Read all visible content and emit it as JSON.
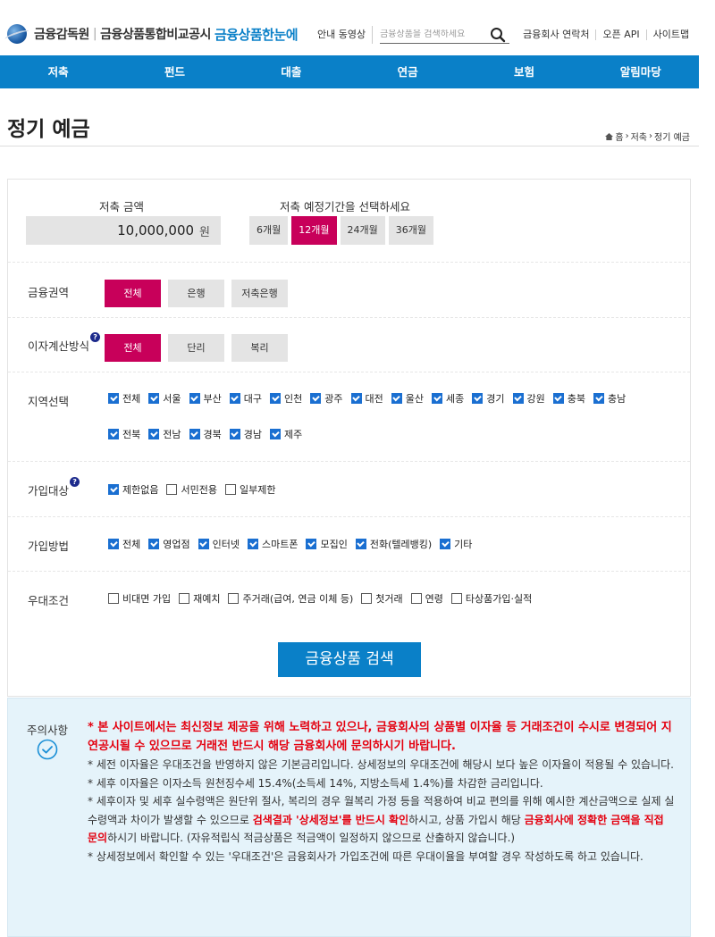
{
  "header": {
    "org1": "금융감독원",
    "org2": "금융상품통합비교공시",
    "brand": "금융상품한눈에",
    "links": [
      "안내 동영상",
      "금융회사 연락처",
      "오픈 API",
      "사이트맵"
    ],
    "search_placeholder": "금융상품을 검색하세요"
  },
  "nav": [
    "저축",
    "펀드",
    "대출",
    "연금",
    "보험",
    "알림마당"
  ],
  "page": {
    "title": "정기 예금",
    "breadcrumb": [
      "홈",
      "저축",
      "정기 예금"
    ]
  },
  "form": {
    "amount_label": "저축 금액",
    "amount_value": "10,000,000",
    "amount_unit": "원",
    "period_label": "저축 예정기간을 선택하세요",
    "periods": [
      "6개월",
      "12개월",
      "24개월",
      "36개월"
    ],
    "period_selected": "12개월",
    "sector_label": "금융권역",
    "sectors": [
      "전체",
      "은행",
      "저축은행"
    ],
    "interest_label": "이자계산방식",
    "interest_opts": [
      "전체",
      "단리",
      "복리"
    ],
    "region_label": "지역선택",
    "regions_row1": [
      "전체",
      "서울",
      "부산",
      "대구",
      "인천",
      "광주",
      "대전",
      "울산",
      "세종",
      "경기",
      "강원",
      "충북",
      "충남"
    ],
    "regions_row2": [
      "전북",
      "전남",
      "경북",
      "경남",
      "제주"
    ],
    "target_label": "가입대상",
    "targets": [
      {
        "label": "제한없음",
        "checked": true
      },
      {
        "label": "서민전용",
        "checked": false
      },
      {
        "label": "일부제한",
        "checked": false
      }
    ],
    "method_label": "가입방법",
    "methods": [
      "전체",
      "영업점",
      "인터넷",
      "스마트폰",
      "모집인",
      "전화(텔레뱅킹)",
      "기타"
    ],
    "pref_label": "우대조건",
    "prefs": [
      "비대면 가입",
      "재예치",
      "주거래(급여, 연금 이체 등)",
      "첫거래",
      "연령",
      "타상품가입·실적"
    ],
    "help_glyph": "?",
    "search_button": "금융상품 검색"
  },
  "notice": {
    "label": "주의사항",
    "lead": "* 본 사이트에서는 최신정보 제공을 위해 노력하고 있으나, 금융회사의 상품별 이자율 등 거래조건이 수시로 변경되어 지연공시될 수 있으므로 거래전 반드시 해당 금융회사에 문의하시기 바랍니다.",
    "p1": "* 세전 이자율은 우대조건을 반영하지 않은 기본금리입니다. 상세정보의 우대조건에 해당시 보다 높은 이자율이 적용될 수 있습니다.",
    "p2": "* 세후 이자율은 이자소득 원천징수세 15.4%(소득세 14%, 지방소득세 1.4%)를 차감한 금리입니다.",
    "p3a": "* 세후이자 및 세후 실수령액은 원단위 절사, 복리의 경우 월복리 가정 등을 적용하여 비교 편의를 위해 예시한 계산금액으로 실제 실수령액과 차이가 발생할 수 있으므로 ",
    "p3b": "검색결과 '상세정보'를 반드시 확인",
    "p3c": "하시고, 상품 가입시 해당 ",
    "p3d": "금융회사에 정확한 금액을 직접 문의",
    "p3e": "하시기 바랍니다. (자유적립식 적금상품은 적금액이 일정하지 않으므로 산출하지 않습니다.)",
    "p4": "* 상세정보에서 확인할 수 있는 '우대조건'은 금융회사가 가입조건에 따른 우대이율을 부여할 경우 작성하도록 하고 있습니다."
  }
}
